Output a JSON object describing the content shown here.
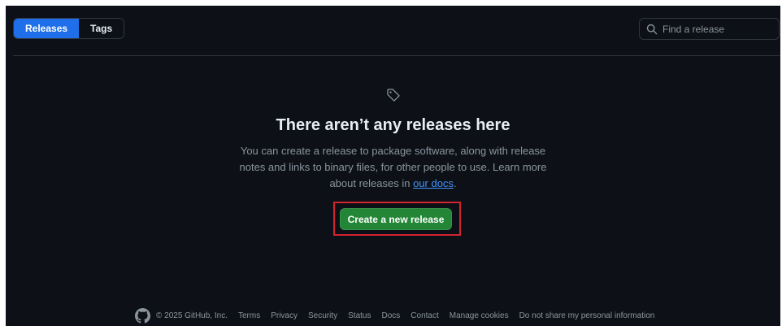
{
  "tabs": [
    {
      "label": "Releases",
      "active": true
    },
    {
      "label": "Tags",
      "active": false
    }
  ],
  "search": {
    "placeholder": "Find a release",
    "value": ""
  },
  "blankslate": {
    "icon": "tag-icon",
    "title": "There aren’t any releases here",
    "description": "You can create a release to package software, along with release notes and links to binary files, for other people to use. Learn more about releases in ",
    "link_label": "our docs",
    "description_end": "."
  },
  "actions": {
    "create_release_label": "Create a new release"
  },
  "footer": {
    "copyright": "© 2025 GitHub, Inc.",
    "links": [
      "Terms",
      "Privacy",
      "Security",
      "Status",
      "Docs",
      "Contact",
      "Manage cookies",
      "Do not share my personal information"
    ]
  },
  "colors": {
    "background": "#0d1117",
    "accent": "#1f6feb",
    "primary_button": "#238636",
    "highlight_box": "#d1242f",
    "link": "#4493f8"
  }
}
